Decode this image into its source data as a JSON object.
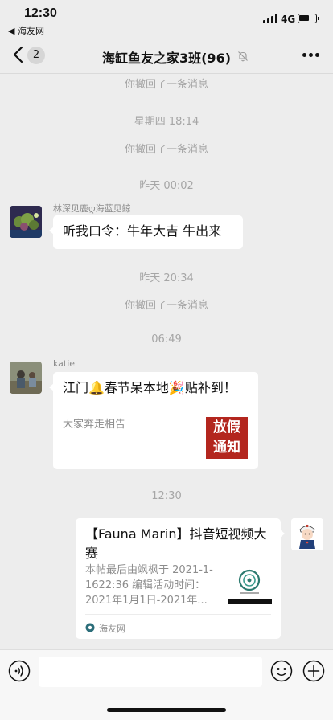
{
  "status_bar": {
    "time": "12:30",
    "back_app": "◀ 海友网",
    "network": "4G"
  },
  "nav": {
    "unread_count": "2",
    "title": "海缸鱼友之家3班(96)"
  },
  "messages": {
    "sys1": "你撤回了一条消息",
    "ts1": "星期四 18:14",
    "sys2": "你撤回了一条消息",
    "ts2": "昨天 00:02",
    "m1": {
      "sender": "林深见鹿ღ海蓝见鲸",
      "text": "听我口令：牛年大吉 牛出来"
    },
    "ts3": "昨天 20:34",
    "sys3": "你撤回了一条消息",
    "ts4": "06:49",
    "m2": {
      "sender": "katie",
      "title": "江门🔔春节呆本地🎉贴补到！",
      "desc": "大家奔走相告",
      "thumb_line1": "放假",
      "thumb_line2": "通知"
    },
    "ts5": "12:30",
    "m3": {
      "title": "【Fauna Marin】抖音短视频大赛",
      "desc": "本帖最后由飒枫于 2021-1-1622:36 编辑活动时间：2021年1月1日-2021年...",
      "source": "海友网"
    }
  },
  "icons": {
    "back": "chevron-left-icon",
    "mute": "mute-bell-icon",
    "more": "more-dots-icon",
    "voice": "voice-icon",
    "emoji": "emoji-icon",
    "plus": "plus-icon"
  }
}
